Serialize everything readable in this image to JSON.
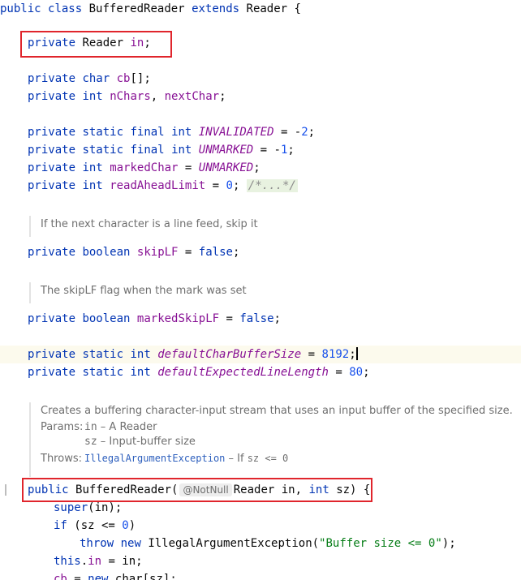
{
  "code": {
    "l1": {
      "k1": "public",
      "k2": "class",
      "name": "BufferedReader",
      "k3": "extends",
      "sup": "Reader",
      "brace": "{"
    },
    "l2": {
      "k1": "private",
      "t": "Reader",
      "f": "in",
      "end": ";"
    },
    "l3": {
      "k1": "private",
      "t": "char",
      "f": "cb",
      "end": "[];"
    },
    "l4": {
      "k1": "private",
      "t": "int",
      "f1": "nChars",
      "sep": ", ",
      "f2": "nextChar",
      "end": ";"
    },
    "l5": {
      "k1": "private",
      "k2": "static",
      "k3": "final",
      "t": "int",
      "f": "INVALIDATED",
      "op": " = -",
      "n": "2",
      "end": ";"
    },
    "l6": {
      "k1": "private",
      "k2": "static",
      "k3": "final",
      "t": "int",
      "f": "UNMARKED",
      "op": " = -",
      "n": "1",
      "end": ";"
    },
    "l7": {
      "k1": "private",
      "t": "int",
      "f": "markedChar",
      "op": " = ",
      "v": "UNMARKED",
      "end": ";"
    },
    "l8": {
      "k1": "private",
      "t": "int",
      "f": "readAheadLimit",
      "op": " = ",
      "n": "0",
      "end": "; ",
      "fold": "/*...*/"
    },
    "doc1": "If the next character is a line feed, skip it",
    "l9": {
      "k1": "private",
      "t": "boolean",
      "f": "skipLF",
      "op": " = ",
      "v": "false",
      "end": ";"
    },
    "doc2": "The skipLF flag when the mark was set",
    "l10": {
      "k1": "private",
      "t": "boolean",
      "f": "markedSkipLF",
      "op": " = ",
      "v": "false",
      "end": ";"
    },
    "l11": {
      "k1": "private",
      "k2": "static",
      "t": "int",
      "f": "defaultCharBufferSize",
      "op": " = ",
      "n": "8192",
      "end": ";"
    },
    "l12": {
      "k1": "private",
      "k2": "static",
      "t": "int",
      "f": "defaultExpectedLineLength",
      "op": " = ",
      "n": "80",
      "end": ";"
    },
    "doc3": {
      "summary": "Creates a buffering character-input stream that uses an input buffer of the specified size.",
      "params_tag": "Params:",
      "p1_name": "in",
      "p1_desc": " – A Reader",
      "p2_name": "sz",
      "p2_desc": " – Input-buffer size",
      "throws_tag": "Throws:",
      "ex": "IllegalArgumentException",
      "ex_desc_a": " – If ",
      "ex_code": "sz <= 0"
    },
    "l13": {
      "k1": "public",
      "name": "BufferedReader(",
      "annot": "@NotNull",
      "t": "Reader",
      "p1": " in, ",
      "t2": "int",
      "p2": " sz) {"
    },
    "l14": {
      "k1": "super",
      "rest": "(in);"
    },
    "l15": {
      "k1": "if",
      "a": " (sz <= ",
      "n": "0",
      "b": ")"
    },
    "l16": {
      "k1": "throw",
      "k2": "new",
      "cls": "IllegalArgumentException(",
      "s": "\"Buffer size <= 0\"",
      "end": ");"
    },
    "l17": {
      "k1": "this",
      "dot": ".",
      "f": "in",
      "rest": " = in;"
    },
    "l18": {
      "f": "cb",
      "op": " = ",
      "k1": "new",
      "rest": "char[sz];"
    }
  }
}
